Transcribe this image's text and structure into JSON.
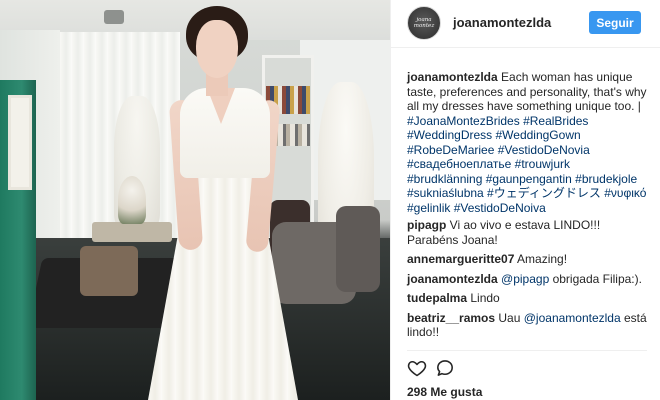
{
  "post": {
    "account": {
      "avatar_text": "joana montez",
      "username": "joanamontezlda"
    },
    "follow_label": "Seguir",
    "caption": {
      "username": "joanamontezlda",
      "text": "Each woman has unique taste, preferences and personality, that's why all my dresses have something unique too. | ",
      "hashtags": "#JoanaMontezBrides #RealBrides #WeddingDress #WeddingGown #RobeDeMariee #VestidoDeNovia #свадебноеплатье #trouwjurk #brudklänning #gaunpengantin #brudekjole #sukniaślubna #ウェディングドレス #νυφικό #gelinlik #VestidoDeNoiva"
    },
    "comments": [
      {
        "username": "pipagp",
        "text": "Vi ao vivo e estava LINDO!!! Parabéns Joana!"
      },
      {
        "username": "annemargueritte07",
        "text": "Amazing!"
      },
      {
        "username": "joanamontezlda",
        "mention": "@pipagp",
        "text": " obrigada Filipa:)."
      },
      {
        "username": "tudepalma",
        "text": "Lindo"
      },
      {
        "username": "beatriz__ramos",
        "text": "Uau ",
        "mention": "@joanamontezlda",
        "text_after": " está lindo!!"
      }
    ],
    "likes_label": "298 Me gusta",
    "icons": {
      "like": "heart-icon",
      "comment": "comment-icon"
    }
  }
}
